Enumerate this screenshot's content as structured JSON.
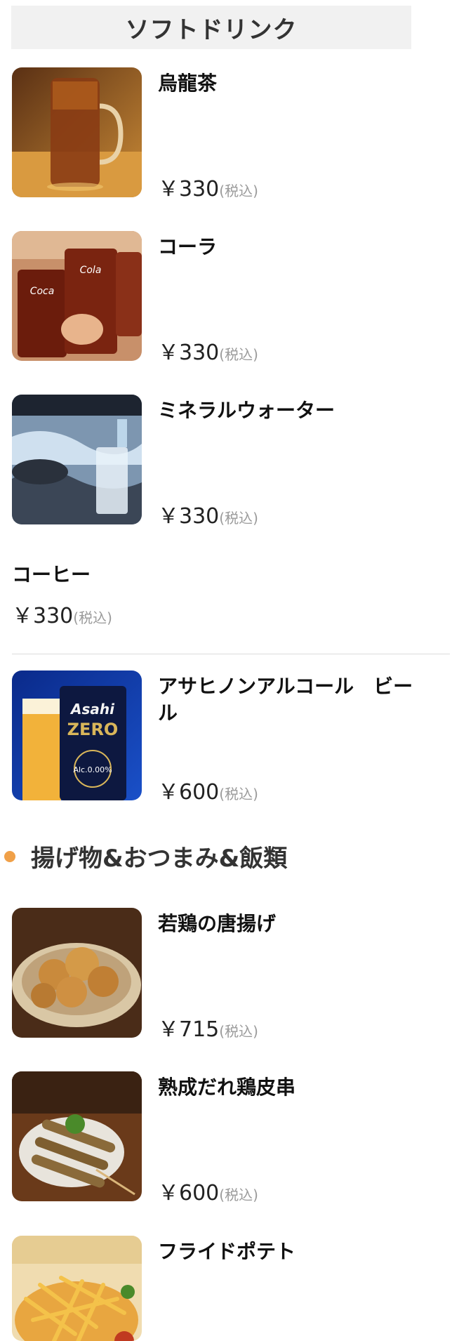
{
  "section": {
    "title": "ソフトドリンク"
  },
  "tax_label": "(税込)",
  "items": [
    {
      "name": "烏龍茶",
      "price": "￥330",
      "image": "oolong-tea-photo"
    },
    {
      "name": "コーラ",
      "price": "￥330",
      "image": "cola-photo"
    },
    {
      "name": "ミネラルウォーター",
      "price": "￥330",
      "image": "mineral-water-photo"
    },
    {
      "name": "コーヒー",
      "price": "￥330"
    },
    {
      "name": "アサヒノンアルコール　ビール",
      "price": "￥600",
      "image": "asahi-zero-photo",
      "image_text": {
        "brand": "Asahi",
        "product": "ZERO",
        "small": "Alc.0.00%"
      }
    },
    {
      "name": "若鶏の唐揚げ",
      "price": "￥715",
      "image": "karaage-photo"
    },
    {
      "name": "熟成だれ鶏皮串",
      "price": "￥600",
      "image": "chicken-skin-skewer-photo"
    },
    {
      "name": "フライドポテト",
      "image": "french-fries-photo"
    }
  ],
  "category": {
    "title": "揚げ物&おつまみ&飯類",
    "dot_color": "#f0a048"
  }
}
